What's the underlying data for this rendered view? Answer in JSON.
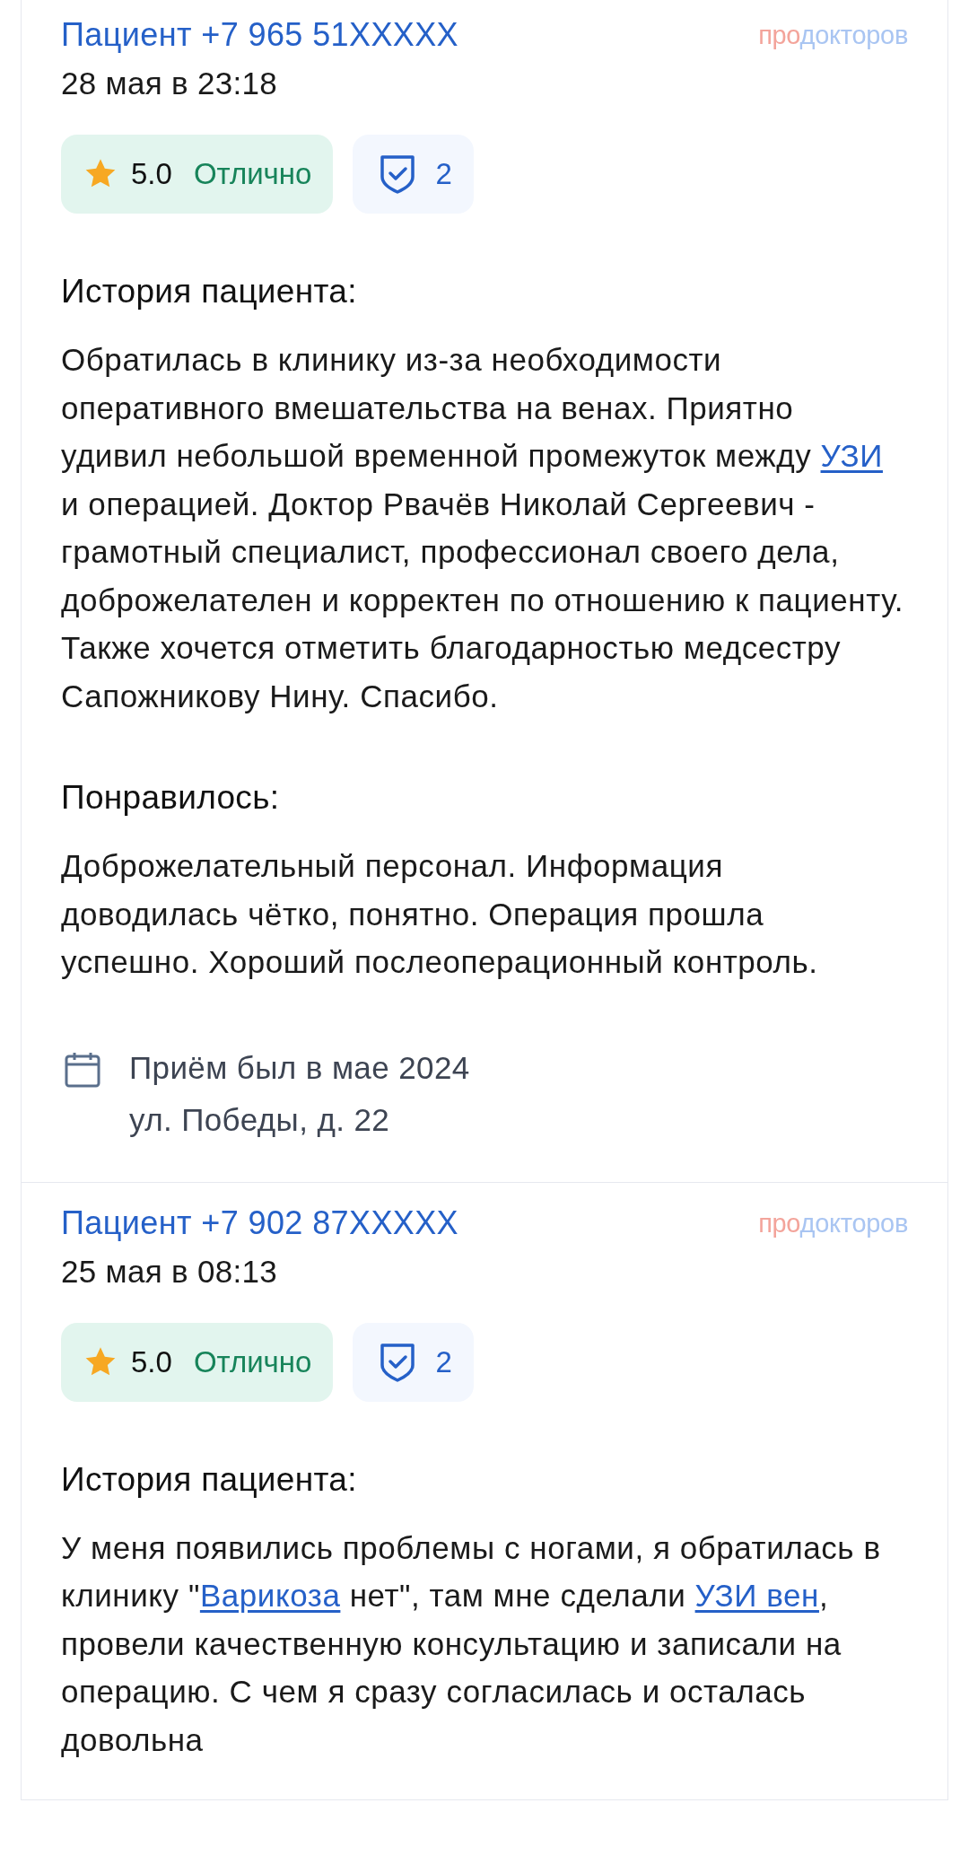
{
  "reviews": [
    {
      "author": "Пациент +7 965 51XXXXX",
      "date": "28 мая в 23:18",
      "logo": {
        "first": "про",
        "second": "докторов"
      },
      "rating": {
        "score": "5.0",
        "verdict": "Отлично"
      },
      "verified": {
        "count": "2"
      },
      "sections": [
        {
          "heading": "История пациента:",
          "parts": [
            {
              "kind": "text",
              "text": "Обратилась в клинику из-за необходимости оперативного вмешательства на венах. Приятно удивил небольшой временной промежуток между "
            },
            {
              "kind": "link",
              "text": "УЗИ"
            },
            {
              "kind": "text",
              "text": " и операцией. Доктор Рвачёв Николай Сергеевич - грамотный специалист, профессионал своего дела, доброжелателен и корректен по отношению к пациенту. Также хочется отметить благодарностью медсестру Сапожникову Нину. Спасибо."
            }
          ]
        },
        {
          "heading": "Понравилось:",
          "parts": [
            {
              "kind": "text",
              "text": "Доброжелательный персонал. Информация доводилась чётко, понятно. Операция прошла успешно. Хороший послеоперационный контроль."
            }
          ]
        }
      ],
      "visit": {
        "when": "Приём был в мае 2024",
        "address": "ул. Победы, д. 22"
      }
    },
    {
      "author": "Пациент +7 902 87XXXXX",
      "date": "25 мая в 08:13",
      "logo": {
        "first": "про",
        "second": "докторов"
      },
      "rating": {
        "score": "5.0",
        "verdict": "Отлично"
      },
      "verified": {
        "count": "2"
      },
      "sections": [
        {
          "heading": "История пациента:",
          "parts": [
            {
              "kind": "text",
              "text": "У меня появились проблемы с ногами, я обратилась в клинику \""
            },
            {
              "kind": "link",
              "text": "Варикоза"
            },
            {
              "kind": "text",
              "text": " нет\", там мне сделали "
            },
            {
              "kind": "link",
              "text": "УЗИ вен"
            },
            {
              "kind": "text",
              "text": ", провели качественную консультацию и записали на операцию. С чем я сразу согласилась и осталась довольна"
            }
          ]
        }
      ]
    }
  ]
}
